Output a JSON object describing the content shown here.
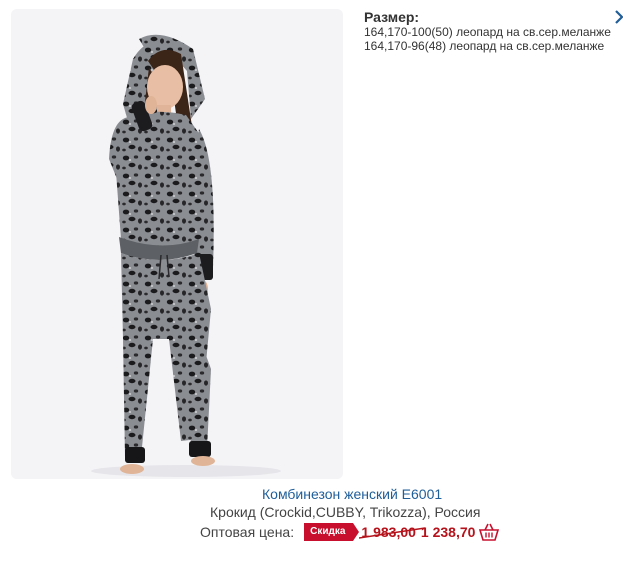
{
  "product": {
    "title": "Комбинезон женский E6001",
    "brand_line": "Крокид (Crockid,CUBBY, Trikozza), Россия",
    "price_label": "Оптовая цена:",
    "discount_badge": "Скидка",
    "old_price": "1 983,00",
    "new_price": "1 238,70",
    "image_icon": "product-photo-leopard-jumpsuit"
  },
  "sizes": {
    "title": "Размер:",
    "items": [
      "164,170-100(50) леопард на св.сер.меланже",
      "164,170-96(48) леопард на св.сер.меланже"
    ]
  },
  "colors": {
    "link": "#1f5e99",
    "price": "#b5121b",
    "badge": "#c8102e",
    "text": "#444444"
  }
}
